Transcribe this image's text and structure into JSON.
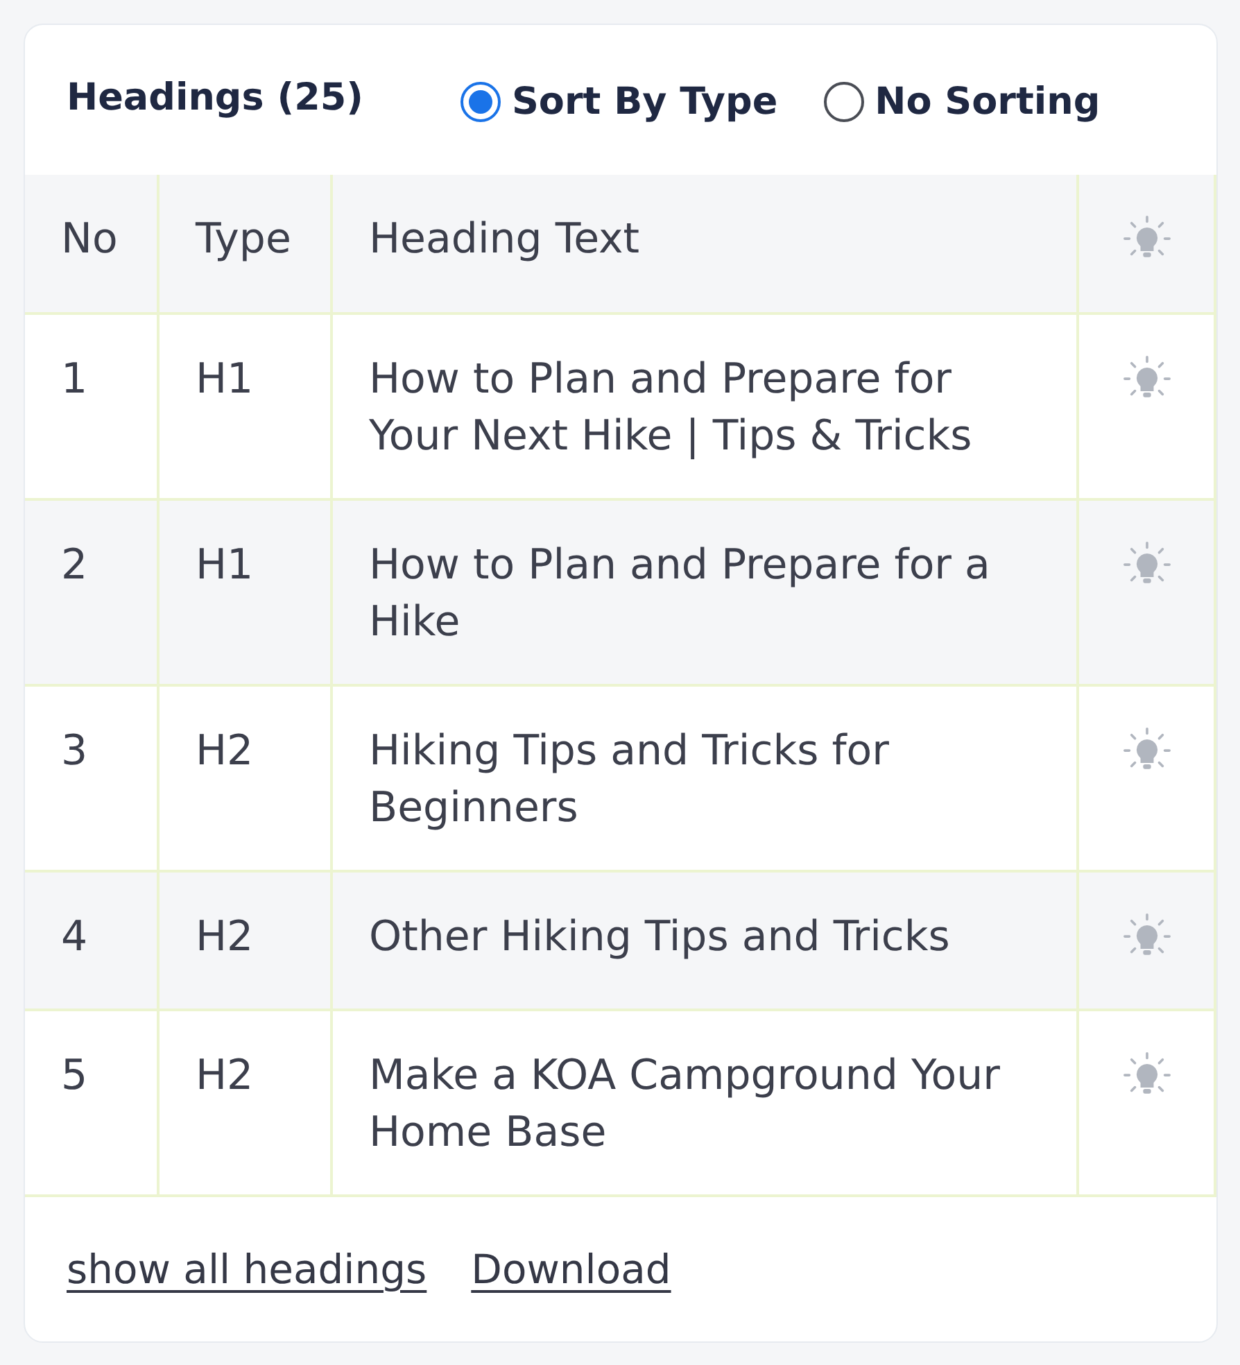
{
  "panel": {
    "title": "Headings (25)",
    "sort_options": [
      {
        "label": "Sort By Type",
        "selected": true
      },
      {
        "label": "No Sorting",
        "selected": false
      }
    ]
  },
  "table": {
    "columns": [
      "No",
      "Type",
      "Heading Text"
    ],
    "rows": [
      {
        "no": "1",
        "type": "H1",
        "text": "How to Plan and Prepare for Your Next Hike | Tips & Tricks"
      },
      {
        "no": "2",
        "type": "H1",
        "text": "How to Plan and Prepare for a Hike"
      },
      {
        "no": "3",
        "type": "H2",
        "text": "Hiking Tips and Tricks for Beginners"
      },
      {
        "no": "4",
        "type": "H2",
        "text": "Other Hiking Tips and Tricks"
      },
      {
        "no": "5",
        "type": "H2",
        "text": "Make a KOA Campground Your Home Base"
      }
    ]
  },
  "footer_links": [
    "show all headings",
    "Download"
  ]
}
